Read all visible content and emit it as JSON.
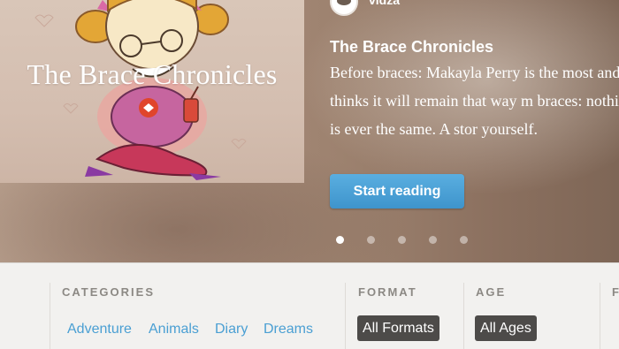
{
  "hero": {
    "author": "vidza",
    "cover_title": "The Brace Chronicles",
    "title": "The Brace Chronicles",
    "description": "Before braces: Makayla Perry is the most and she thinks it will remain that way m braces: nothing is ever the same. A stor yourself.",
    "cta": "Start reading",
    "slides": 5,
    "active_slide": 1
  },
  "filters": {
    "categories": {
      "heading": "CATEGORIES",
      "items": [
        "Adventure",
        "Animals",
        "Diary",
        "Dreams"
      ]
    },
    "format": {
      "heading": "FORMAT",
      "selected": "All Formats"
    },
    "age": {
      "heading": "AGE",
      "selected": "All Ages"
    },
    "fourth": {
      "heading": "F"
    }
  },
  "colors": {
    "accent_blue": "#4a9fd3",
    "button_blue": "#4ba1d8",
    "pill_dark": "#4d4b49"
  }
}
